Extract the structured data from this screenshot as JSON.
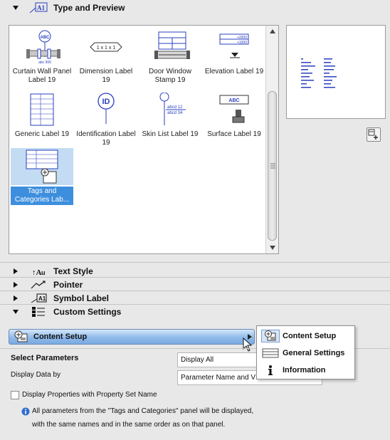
{
  "sections": {
    "type_preview": {
      "title": "Type and Preview"
    },
    "text_style": {
      "title": "Text Style"
    },
    "pointer": {
      "title": "Pointer"
    },
    "symbol_label": {
      "title": "Symbol Label"
    },
    "custom_settings": {
      "title": "Custom Settings"
    }
  },
  "label_types": [
    {
      "name": "Curtain Wall Panel Label 19"
    },
    {
      "name": "Dimension Label 19"
    },
    {
      "name": "Door Window Stamp 19"
    },
    {
      "name": "Elevation Label 19"
    },
    {
      "name": "Generic Label 19"
    },
    {
      "name": "Identification Label 19"
    },
    {
      "name": "Skin List Label 19"
    },
    {
      "name": "Surface Label 19"
    },
    {
      "name": "Tags and Categories Lab...",
      "selected": true
    }
  ],
  "thumb_text": {
    "abc": "ABC",
    "abc900": "abc 900",
    "dim": "1 x 1 x 1",
    "id": "ID",
    "elev1": "+2000",
    "elev2": "+1000",
    "abcd12": "abcd 12",
    "abcd34": "abcd 34"
  },
  "content_setup": {
    "label": "Content Setup"
  },
  "parameters": {
    "select_label": "Select Parameters",
    "select_value": "Display All",
    "display_by_label": "Display Data by",
    "display_by_value": "Parameter Name and V",
    "checkbox_label": "Display Properties with Property Set Name",
    "info_line1": "All parameters from the \"Tags and Categories\" panel will be displayed,",
    "info_line2": "with the same names and in the same order as on that panel."
  },
  "menu": {
    "items": [
      {
        "label": "Content Setup",
        "icon": "content-setup-icon",
        "active": true
      },
      {
        "label": "General Settings",
        "icon": "general-settings-icon",
        "active": false
      },
      {
        "label": "Information",
        "icon": "information-icon",
        "active": false
      }
    ]
  },
  "colors": {
    "accent": "#3d8fde",
    "label_blue": "#2a3fbf"
  }
}
